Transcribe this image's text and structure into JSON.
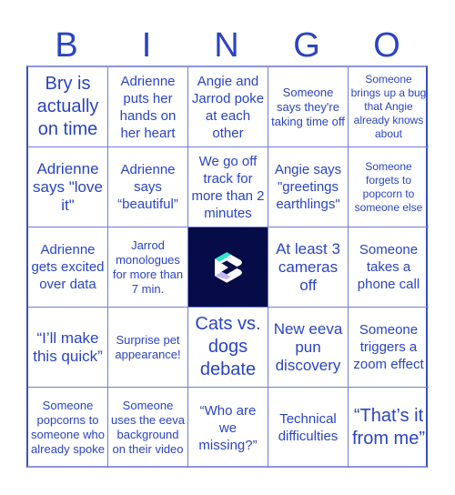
{
  "card": {
    "header_letters": [
      "B",
      "I",
      "N",
      "G",
      "O"
    ],
    "accent_color": "#2a44c2",
    "free_space": {
      "icon": "eeva-logo-icon",
      "background": "#050c47",
      "colors": {
        "teal": "#2fe6c8",
        "lavender": "#c7b8f5",
        "white": "#ffffff"
      }
    },
    "cells": [
      [
        "Bry is actually on time",
        "Adrienne puts her hands on her heart",
        "Angie and Jarrod poke at each other",
        "Someone says they're taking time off",
        "Someone brings up a bug that Angie already knows about"
      ],
      [
        "Adrienne says \"love it\"",
        "Adrienne says “beautiful”",
        "We go off track for more than 2 minutes",
        "Angie says \"greetings earthlings\"",
        "Someone forgets to popcorn to someone else"
      ],
      [
        "Adrienne gets excited over data",
        "Jarrod monologues for more than 7 min.",
        "",
        "At least 3 cameras off",
        "Someone takes a phone call"
      ],
      [
        "“I’ll make this quick”",
        "Surprise pet appearance!",
        "Cats vs. dogs debate",
        "New eeva pun discovery",
        "Someone triggers a zoom effect"
      ],
      [
        "Someone popcorns to someone who already spoke",
        "Someone uses the eeva background on their video",
        "“Who are we missing?”",
        "Technical difficulties",
        "“That’s it from me”"
      ]
    ]
  }
}
